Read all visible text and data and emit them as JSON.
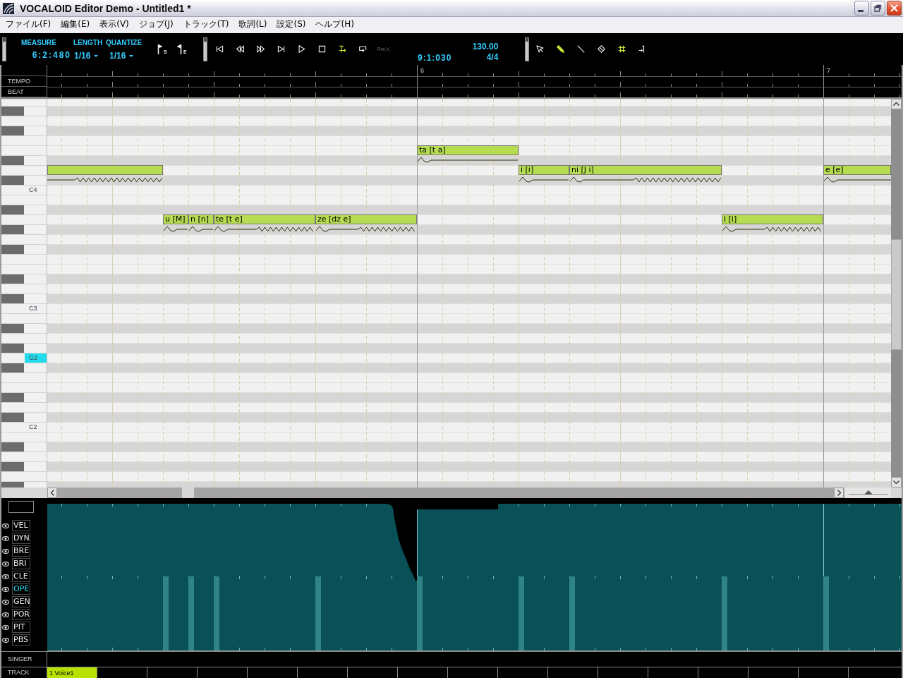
{
  "window": {
    "title": "VOCALOID Editor Demo - Untitled1 *"
  },
  "menu": [
    "ファイル(F)",
    "編集(E)",
    "表示(V)",
    "ジョブ(J)",
    "トラック(T)",
    "歌詞(L)",
    "設定(S)",
    "ヘルプ(H)"
  ],
  "toolbar": {
    "measure_label": "MEASURE",
    "length_label": "LENGTH",
    "quantize_label": "QUANTIZE",
    "measure": "6:2:480",
    "length": "1/16",
    "quantize": "1/16",
    "markers": [
      {
        "label": "S"
      },
      {
        "label": "E"
      }
    ],
    "transport": [
      {
        "kind": "to-start",
        "on": false,
        "disabled": false
      },
      {
        "kind": "rewind",
        "on": false,
        "disabled": false
      },
      {
        "kind": "forward",
        "on": false,
        "disabled": false
      },
      {
        "kind": "to-end",
        "on": false,
        "disabled": false
      },
      {
        "kind": "play",
        "on": false,
        "disabled": false
      },
      {
        "kind": "stop",
        "on": false,
        "disabled": false
      },
      {
        "kind": "follow",
        "on": true,
        "disabled": false
      },
      {
        "kind": "loop",
        "on": false,
        "disabled": false
      },
      {
        "kind": "realtime",
        "label": "Rw",
        "on": false,
        "disabled": true
      }
    ],
    "position": "9:1:030",
    "tempo": "130.00",
    "time_signature": "4/4",
    "tools": [
      {
        "kind": "pointer",
        "selected": false
      },
      {
        "kind": "pencil",
        "selected": true
      },
      {
        "kind": "line",
        "selected": false
      },
      {
        "kind": "eraser",
        "selected": false
      }
    ],
    "grid": {
      "on": true
    }
  },
  "ruler": {
    "rows": [
      "TEMPO",
      "BEAT"
    ],
    "measures": [
      "6",
      "7"
    ]
  },
  "keyboard": {
    "keys": [
      {
        "label": "C4",
        "selected": false
      },
      {
        "label": "C3",
        "selected": false
      },
      {
        "label": "G2",
        "selected": true
      },
      {
        "label": "C2",
        "selected": false
      }
    ]
  },
  "notes": [
    {
      "vibrato": true
    },
    {
      "lyric": "u [M]",
      "vibrato": false
    },
    {
      "lyric": "n [n]",
      "vibrato": false
    },
    {
      "lyric": "te [t e]",
      "vibrato": true
    },
    {
      "lyric": "ze [dz e]",
      "vibrato": true
    },
    {
      "lyric": "ta [t a]",
      "vibrato": false
    },
    {
      "lyric": "i [i]",
      "vibrato": false
    },
    {
      "lyric": "ni [J i]",
      "vibrato": true
    },
    {
      "lyric": "i [i]",
      "vibrato": true
    },
    {
      "lyric": "e [e]",
      "vibrato": false
    }
  ],
  "zoom": {
    "level": 0.5
  },
  "controls": [
    {
      "label": "VEL",
      "selected": false
    },
    {
      "label": "DYN",
      "selected": false
    },
    {
      "label": "BRE",
      "selected": false
    },
    {
      "label": "BRI",
      "selected": false
    },
    {
      "label": "CLE",
      "selected": false
    },
    {
      "label": "OPE",
      "selected": true
    },
    {
      "label": "GEN",
      "selected": false
    },
    {
      "label": "POR",
      "selected": false
    },
    {
      "label": "PIT",
      "selected": false
    },
    {
      "label": "PBS",
      "selected": false
    }
  ],
  "singer": {
    "label": "SINGER"
  },
  "tracks": {
    "label": "TRACK",
    "items": [
      {
        "name": "1 Voice1",
        "selected": true
      }
    ]
  }
}
